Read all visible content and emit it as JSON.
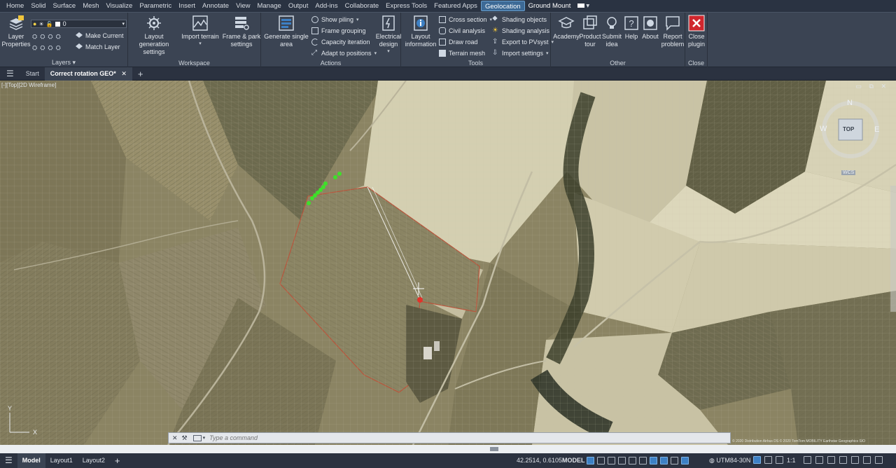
{
  "ribbon_tabs": [
    {
      "label": "Home"
    },
    {
      "label": "Solid"
    },
    {
      "label": "Surface"
    },
    {
      "label": "Mesh"
    },
    {
      "label": "Visualize"
    },
    {
      "label": "Parametric"
    },
    {
      "label": "Insert"
    },
    {
      "label": "Annotate"
    },
    {
      "label": "View"
    },
    {
      "label": "Manage"
    },
    {
      "label": "Output"
    },
    {
      "label": "Add-ins"
    },
    {
      "label": "Collaborate"
    },
    {
      "label": "Express Tools"
    },
    {
      "label": "Featured Apps"
    },
    {
      "label": "Geolocation"
    },
    {
      "label": "Ground Mount"
    }
  ],
  "layers": {
    "layer_properties": "Layer\nProperties",
    "layer_value": "0",
    "make_current": "Make Current",
    "match_layer": "Match Layer",
    "title": "Layers"
  },
  "workspace": {
    "layout_gen": "Layout generation\nsettings",
    "import_terrain": "Import terrain",
    "frame_park": "Frame & park\nsettings",
    "title": "Workspace"
  },
  "actions": {
    "generate_single": "Generate single\narea",
    "show_piling": "Show piling",
    "frame_grouping": "Frame grouping",
    "capacity_iteration": "Capacity iteration",
    "adapt_positions": "Adapt to positions",
    "electrical_design": "Electrical\ndesign",
    "title": "Actions"
  },
  "tools": {
    "layout_info": "Layout\ninformation",
    "cross_section": "Cross section",
    "civil_analysis": "Civil analysis",
    "draw_road": "Draw road",
    "terrain_mesh": "Terrain mesh",
    "shading_objects": "Shading objects",
    "shading_analysis": "Shading analysis",
    "export_pvsyst": "Export to PVsyst",
    "import_settings": "Import settings",
    "title": "Tools"
  },
  "other": {
    "academy": "Academy",
    "product_tour": "Product\ntour",
    "submit_idea": "Submit\nidea",
    "help": "Help",
    "about": "About",
    "report_problem": "Report\nproblem",
    "title": "Other"
  },
  "close": {
    "close_plugin": "Close\nplugin",
    "title": "Close"
  },
  "file_tabs": {
    "start": "Start",
    "active": "Correct rotation GEO*"
  },
  "viewport": {
    "label": "[-][Top][2D Wireframe]",
    "compass": {
      "n": "N",
      "s": "S",
      "e": "E",
      "w": "W",
      "top": "TOP",
      "wcs": "WCS"
    },
    "attribution": "© 2020 Distribution Airbus DS © 2020 TomTom MOBILITY Earthstar Geographics SIO"
  },
  "command": {
    "placeholder": "Type a command"
  },
  "status": {
    "model_tab": "Model",
    "layout1": "Layout1",
    "layout2": "Layout2",
    "coords": "42.2514, 0.6105",
    "model": "MODEL",
    "coord_system": "UTM84-30N",
    "scale": "1:1"
  },
  "colors": {
    "ribbon": "#3b4453",
    "active_tab": "#3d6a96",
    "close_button": "#d0262d",
    "piles": "#3ee02a",
    "boundary": "#b8553c"
  }
}
